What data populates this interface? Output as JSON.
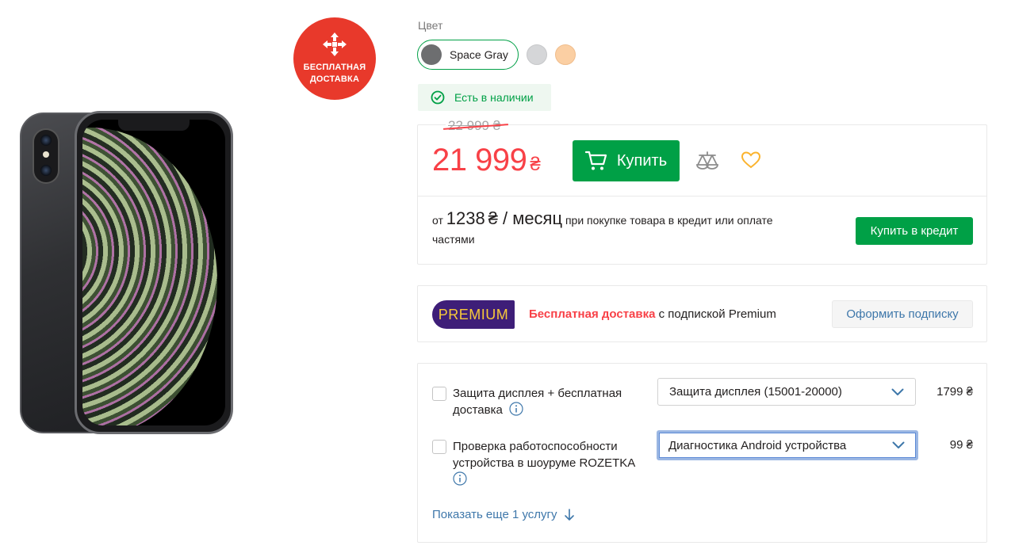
{
  "delivery_badge": {
    "line1": "БЕСПЛАТНАЯ",
    "line2": "ДОСТАВКА"
  },
  "color": {
    "label": "Цвет",
    "selected_name": "Space Gray",
    "options": [
      "#6d6e70",
      "#d5d6d8",
      "#fbcfa3"
    ]
  },
  "stock": {
    "text": "Есть в наличии"
  },
  "price": {
    "old": "22 999 ₴",
    "current": "21 999",
    "currency": "₴",
    "buy_label": "Купить"
  },
  "credit": {
    "prefix": "от",
    "amount": "1238",
    "per_month": "₴ / месяц",
    "description": "при покупке товара в кредит или оплате частями",
    "button_label": "Купить в кредит"
  },
  "premium": {
    "logo": "PREMIUM",
    "highlight": "Бесплатная доставка",
    "text": " с подпиской Premium",
    "button_label": "Оформить подписку"
  },
  "services": [
    {
      "label": "Защита дисплея + бесплатная доставка",
      "select_value": "Защита дисплея (15001-20000)",
      "price": "1799 ₴"
    },
    {
      "label": "Проверка работоспособности устройства в шоуруме ROZETKA",
      "select_value": "Диагностика Android устройства",
      "price": "99 ₴"
    }
  ],
  "show_more": "Показать еще 1 услугу"
}
